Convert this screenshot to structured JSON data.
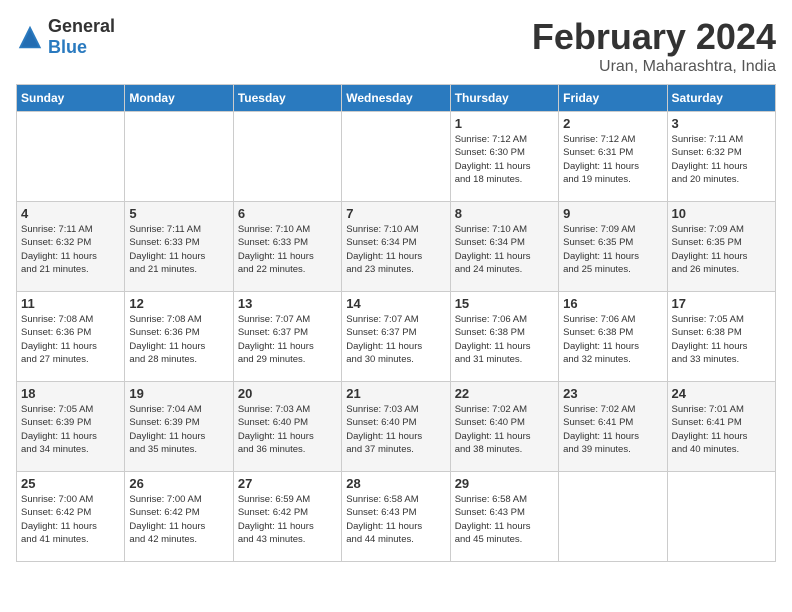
{
  "header": {
    "logo_general": "General",
    "logo_blue": "Blue",
    "title": "February 2024",
    "location": "Uran, Maharashtra, India"
  },
  "weekdays": [
    "Sunday",
    "Monday",
    "Tuesday",
    "Wednesday",
    "Thursday",
    "Friday",
    "Saturday"
  ],
  "weeks": [
    [
      {
        "day": "",
        "info": ""
      },
      {
        "day": "",
        "info": ""
      },
      {
        "day": "",
        "info": ""
      },
      {
        "day": "",
        "info": ""
      },
      {
        "day": "1",
        "info": "Sunrise: 7:12 AM\nSunset: 6:30 PM\nDaylight: 11 hours\nand 18 minutes."
      },
      {
        "day": "2",
        "info": "Sunrise: 7:12 AM\nSunset: 6:31 PM\nDaylight: 11 hours\nand 19 minutes."
      },
      {
        "day": "3",
        "info": "Sunrise: 7:11 AM\nSunset: 6:32 PM\nDaylight: 11 hours\nand 20 minutes."
      }
    ],
    [
      {
        "day": "4",
        "info": "Sunrise: 7:11 AM\nSunset: 6:32 PM\nDaylight: 11 hours\nand 21 minutes."
      },
      {
        "day": "5",
        "info": "Sunrise: 7:11 AM\nSunset: 6:33 PM\nDaylight: 11 hours\nand 21 minutes."
      },
      {
        "day": "6",
        "info": "Sunrise: 7:10 AM\nSunset: 6:33 PM\nDaylight: 11 hours\nand 22 minutes."
      },
      {
        "day": "7",
        "info": "Sunrise: 7:10 AM\nSunset: 6:34 PM\nDaylight: 11 hours\nand 23 minutes."
      },
      {
        "day": "8",
        "info": "Sunrise: 7:10 AM\nSunset: 6:34 PM\nDaylight: 11 hours\nand 24 minutes."
      },
      {
        "day": "9",
        "info": "Sunrise: 7:09 AM\nSunset: 6:35 PM\nDaylight: 11 hours\nand 25 minutes."
      },
      {
        "day": "10",
        "info": "Sunrise: 7:09 AM\nSunset: 6:35 PM\nDaylight: 11 hours\nand 26 minutes."
      }
    ],
    [
      {
        "day": "11",
        "info": "Sunrise: 7:08 AM\nSunset: 6:36 PM\nDaylight: 11 hours\nand 27 minutes."
      },
      {
        "day": "12",
        "info": "Sunrise: 7:08 AM\nSunset: 6:36 PM\nDaylight: 11 hours\nand 28 minutes."
      },
      {
        "day": "13",
        "info": "Sunrise: 7:07 AM\nSunset: 6:37 PM\nDaylight: 11 hours\nand 29 minutes."
      },
      {
        "day": "14",
        "info": "Sunrise: 7:07 AM\nSunset: 6:37 PM\nDaylight: 11 hours\nand 30 minutes."
      },
      {
        "day": "15",
        "info": "Sunrise: 7:06 AM\nSunset: 6:38 PM\nDaylight: 11 hours\nand 31 minutes."
      },
      {
        "day": "16",
        "info": "Sunrise: 7:06 AM\nSunset: 6:38 PM\nDaylight: 11 hours\nand 32 minutes."
      },
      {
        "day": "17",
        "info": "Sunrise: 7:05 AM\nSunset: 6:38 PM\nDaylight: 11 hours\nand 33 minutes."
      }
    ],
    [
      {
        "day": "18",
        "info": "Sunrise: 7:05 AM\nSunset: 6:39 PM\nDaylight: 11 hours\nand 34 minutes."
      },
      {
        "day": "19",
        "info": "Sunrise: 7:04 AM\nSunset: 6:39 PM\nDaylight: 11 hours\nand 35 minutes."
      },
      {
        "day": "20",
        "info": "Sunrise: 7:03 AM\nSunset: 6:40 PM\nDaylight: 11 hours\nand 36 minutes."
      },
      {
        "day": "21",
        "info": "Sunrise: 7:03 AM\nSunset: 6:40 PM\nDaylight: 11 hours\nand 37 minutes."
      },
      {
        "day": "22",
        "info": "Sunrise: 7:02 AM\nSunset: 6:40 PM\nDaylight: 11 hours\nand 38 minutes."
      },
      {
        "day": "23",
        "info": "Sunrise: 7:02 AM\nSunset: 6:41 PM\nDaylight: 11 hours\nand 39 minutes."
      },
      {
        "day": "24",
        "info": "Sunrise: 7:01 AM\nSunset: 6:41 PM\nDaylight: 11 hours\nand 40 minutes."
      }
    ],
    [
      {
        "day": "25",
        "info": "Sunrise: 7:00 AM\nSunset: 6:42 PM\nDaylight: 11 hours\nand 41 minutes."
      },
      {
        "day": "26",
        "info": "Sunrise: 7:00 AM\nSunset: 6:42 PM\nDaylight: 11 hours\nand 42 minutes."
      },
      {
        "day": "27",
        "info": "Sunrise: 6:59 AM\nSunset: 6:42 PM\nDaylight: 11 hours\nand 43 minutes."
      },
      {
        "day": "28",
        "info": "Sunrise: 6:58 AM\nSunset: 6:43 PM\nDaylight: 11 hours\nand 44 minutes."
      },
      {
        "day": "29",
        "info": "Sunrise: 6:58 AM\nSunset: 6:43 PM\nDaylight: 11 hours\nand 45 minutes."
      },
      {
        "day": "",
        "info": ""
      },
      {
        "day": "",
        "info": ""
      }
    ]
  ]
}
